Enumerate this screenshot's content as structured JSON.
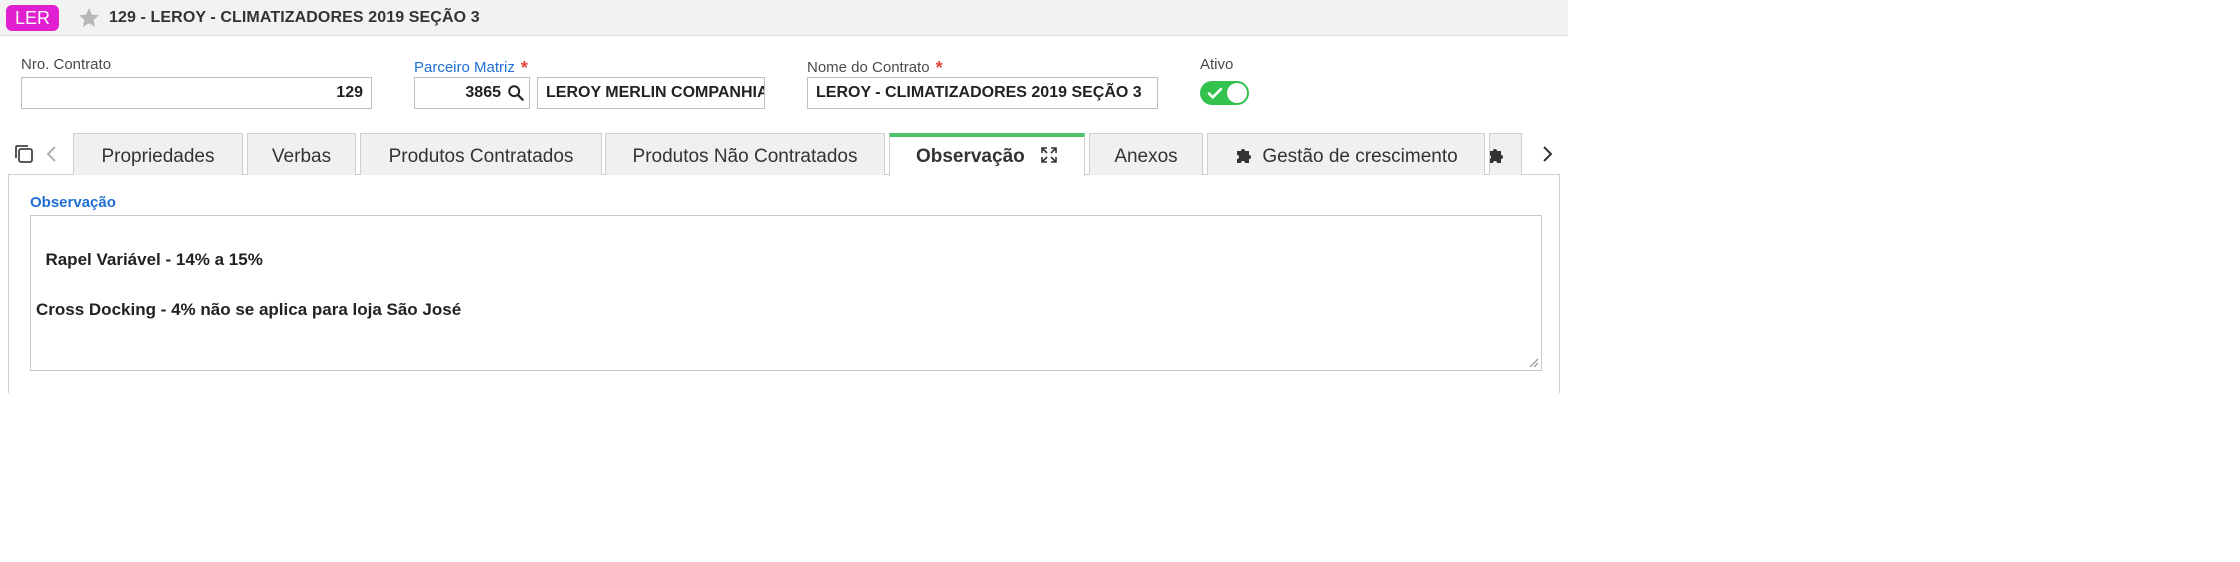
{
  "header": {
    "app_badge": "LER",
    "title": "129 - LEROY - CLIMATIZADORES 2019 SEÇÃO 3",
    "star_icon": "star-icon"
  },
  "form": {
    "contract_number": {
      "label": "Nro. Contrato",
      "value": "129"
    },
    "partner": {
      "label": "Parceiro Matriz",
      "required_mark": "*",
      "code": "3865",
      "name": "LEROY MERLIN COMPANHIA BRASILEIRA DE BRICOLAGEM"
    },
    "contract_name": {
      "label": "Nome do Contrato",
      "required_mark": "*",
      "value": "LEROY - CLIMATIZADORES 2019 SEÇÃO 3"
    },
    "active": {
      "label": "Ativo",
      "value": true,
      "on_color": "#32c24d"
    }
  },
  "tabs": [
    {
      "label": "Propriedades",
      "active": false
    },
    {
      "label": "Verbas",
      "active": false
    },
    {
      "label": "Produtos Contratados",
      "active": false
    },
    {
      "label": "Produtos Não Contratados",
      "active": false
    },
    {
      "label": "Observação",
      "active": true
    },
    {
      "label": "Anexos",
      "active": false
    },
    {
      "label": "Gestão de crescimento",
      "active": false,
      "icon": "puzzle-icon"
    }
  ],
  "observation": {
    "label": "Observação",
    "text": "Rapel Variável - 14% a 15%\n\nCross Docking - 4% não se aplica para loja São José"
  },
  "colors": {
    "accent_blue": "#1f6fd6",
    "active_tab_border": "#4cc26a",
    "badge": "#e21fd0",
    "required": "#e0463c"
  }
}
